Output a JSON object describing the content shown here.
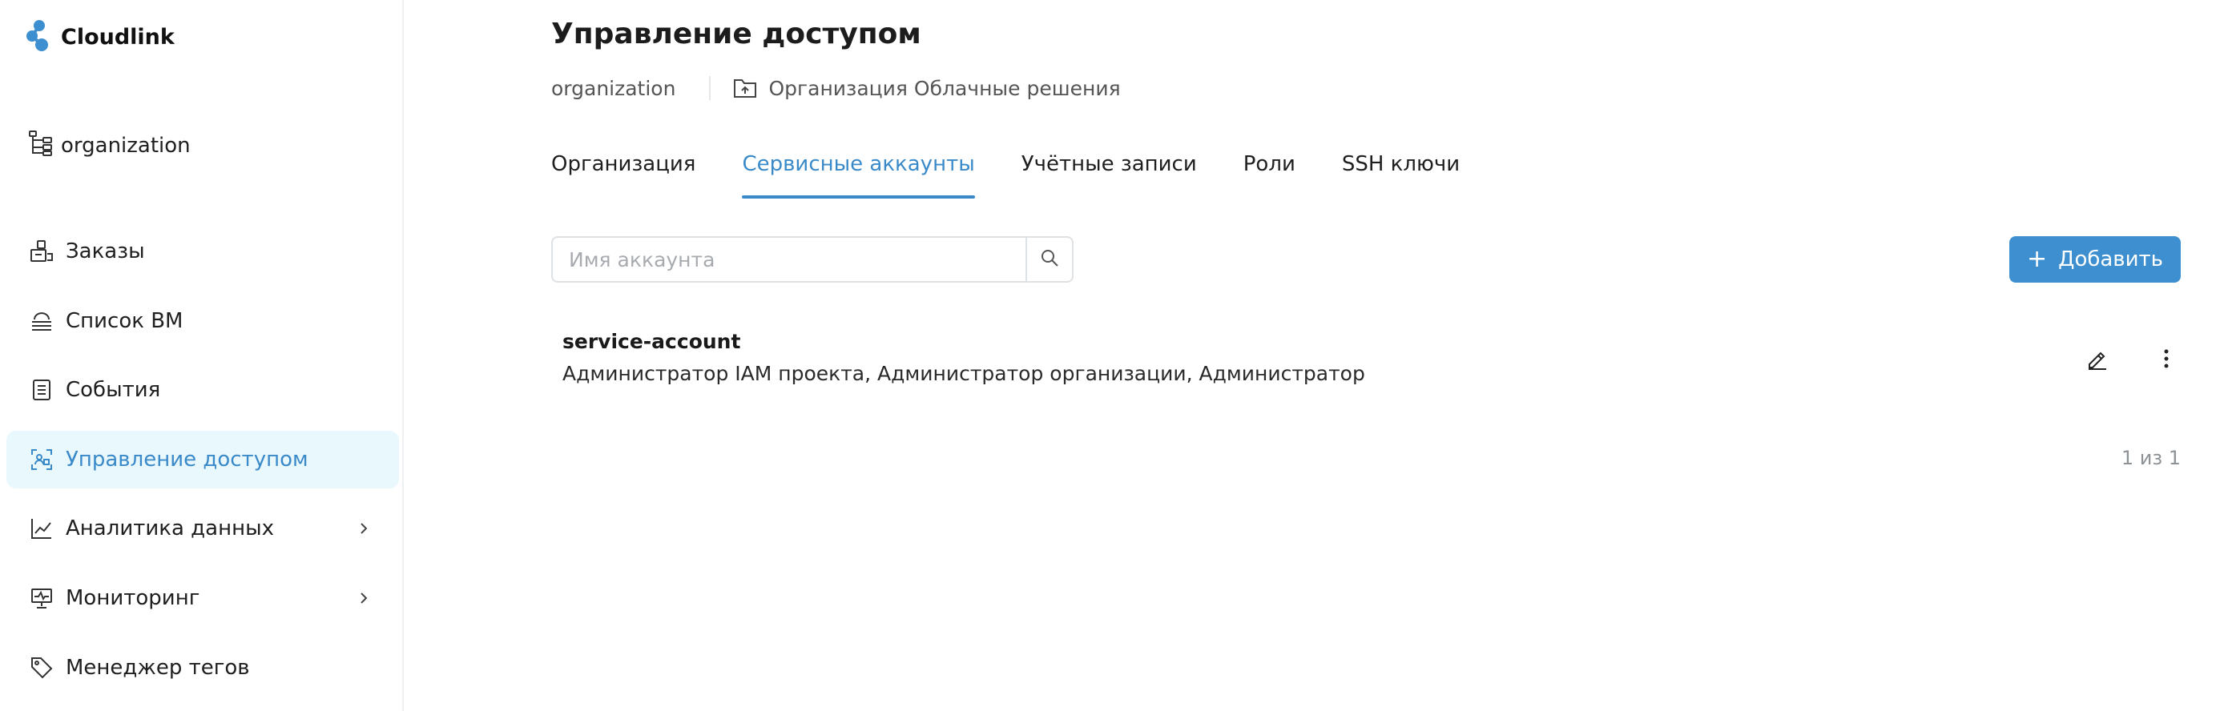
{
  "app": {
    "name": "Cloudlink"
  },
  "sidebar": {
    "organization": "organization",
    "items": [
      {
        "label": "Заказы",
        "icon": "orders-icon"
      },
      {
        "label": "Список ВМ",
        "icon": "cloud-stack-icon"
      },
      {
        "label": "События",
        "icon": "events-list-icon"
      },
      {
        "label": "Управление доступом",
        "icon": "access-control-icon",
        "active": true
      },
      {
        "label": "Аналитика данных",
        "icon": "analytics-chart-icon",
        "expandable": true
      },
      {
        "label": "Мониторинг",
        "icon": "monitoring-icon",
        "expandable": true
      },
      {
        "label": "Менеджер тегов",
        "icon": "tag-icon"
      }
    ]
  },
  "page": {
    "title": "Управление доступом",
    "breadcrumb": {
      "org": "organization",
      "folder": "Организация Облачные решения"
    }
  },
  "tabs": [
    {
      "label": "Организация"
    },
    {
      "label": "Сервисные аккаунты",
      "active": true
    },
    {
      "label": "Учётные записи"
    },
    {
      "label": "Роли"
    },
    {
      "label": "SSH ключи"
    }
  ],
  "search": {
    "placeholder": "Имя аккаунта",
    "value": ""
  },
  "add_button": {
    "label": "Добавить"
  },
  "accounts": [
    {
      "name": "service-account",
      "roles": "Администратор IAM проекта, Администратор организации, Администратор"
    }
  ],
  "pagination": {
    "text": "1 из 1"
  },
  "colors": {
    "accent": "#3d8fcf",
    "active_bg": "#e9f8fd",
    "active_text": "#3a8ac9"
  }
}
